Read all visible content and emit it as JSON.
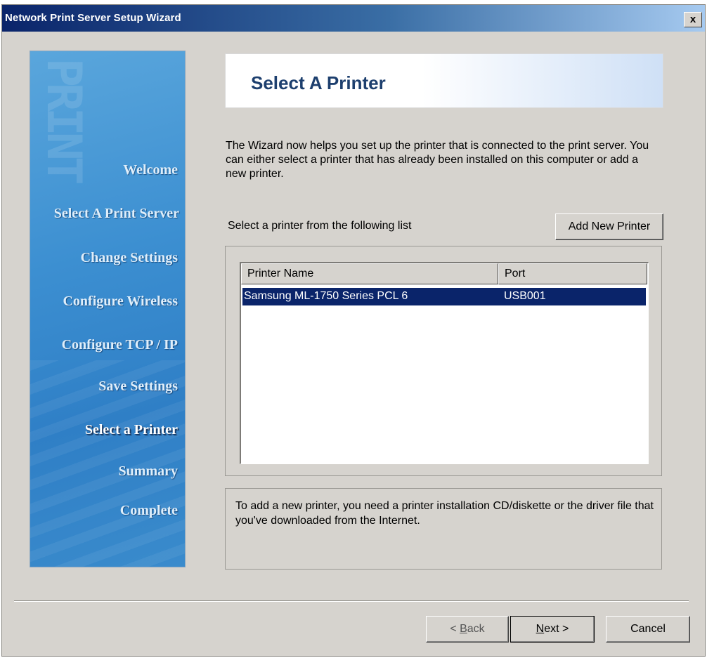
{
  "window": {
    "title": "Network Print Server Setup Wizard",
    "close_label": "x"
  },
  "sidebar": {
    "logo_text": "PRINT",
    "items": [
      {
        "label": "Welcome",
        "active": false
      },
      {
        "label": "Select A Print Server",
        "active": false
      },
      {
        "label": "Change Settings",
        "active": false
      },
      {
        "label": "Configure Wireless",
        "active": false
      },
      {
        "label": "Configure TCP / IP",
        "active": false
      },
      {
        "label": "Save Settings",
        "active": false
      },
      {
        "label": "Select a Printer",
        "active": true
      },
      {
        "label": "Summary",
        "active": false
      },
      {
        "label": "Complete",
        "active": false
      }
    ]
  },
  "header": {
    "title": "Select A Printer"
  },
  "intro": "The Wizard now helps you set up the printer that is connected to the print server. You can either select a printer that has already been installed on this computer or add a new printer.",
  "printer_list": {
    "label": "Select a printer from the following list",
    "add_button": "Add New Printer",
    "columns": [
      "Printer Name",
      "Port"
    ],
    "rows": [
      {
        "name": "Samsung ML-1750 Series PCL 6",
        "port": "USB001",
        "selected": true
      }
    ]
  },
  "info": "To add a new printer, you need a printer installation CD/diskette or the driver file that you've downloaded from the Internet.",
  "footer": {
    "back_prefix": "< ",
    "back_key": "B",
    "back_rest": "ack",
    "next_key": "N",
    "next_rest": "ext >",
    "cancel": "Cancel"
  },
  "colors": {
    "title_bar": "#0a246a",
    "sidebar_blue": "#3c8fd1",
    "selection": "#0a246a",
    "header_text": "#1d3f6e",
    "dialog_face": "#d6d3ce"
  }
}
